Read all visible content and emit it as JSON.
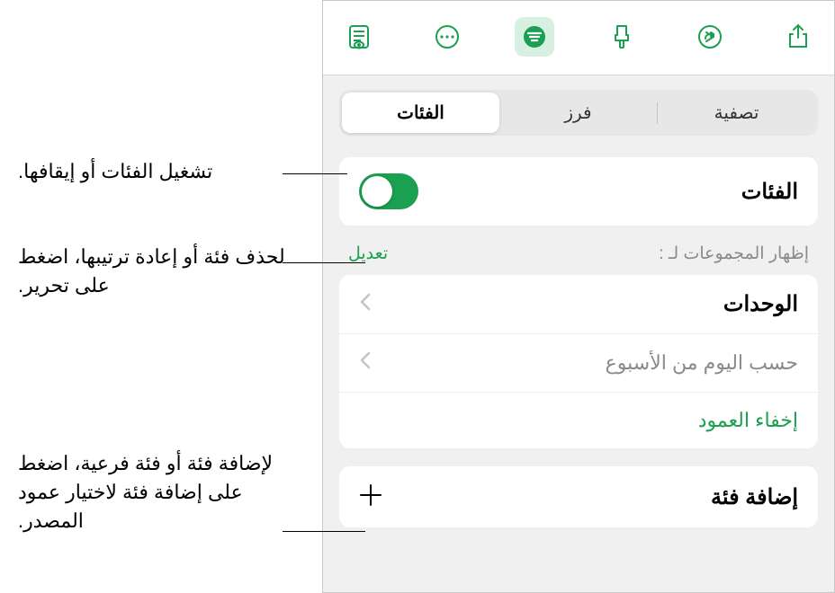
{
  "colors": {
    "accent": "#1aa050",
    "panel_bg": "#eff0ef",
    "placeholder": "#8a8a8a"
  },
  "toolbar_icons": {
    "share": "share-icon",
    "redo": "redo-arrow-icon",
    "format": "format-brush-icon",
    "organize": "organize-icon",
    "more": "more-ellipsis-icon",
    "view": "view-options-icon"
  },
  "segmented": {
    "tab1": "الفئات",
    "tab2": "فرز",
    "tab3": "تصفية",
    "selected": "الفئات"
  },
  "categories_row": {
    "label": "الفئات",
    "toggle_on": true
  },
  "groups_header": {
    "label": "إظهار المجموعات لـ :",
    "edit": "تعديل"
  },
  "group_rows": [
    {
      "label": "الوحدات",
      "secondary": false
    },
    {
      "label": "حسب اليوم من الأسبوع",
      "secondary": true
    }
  ],
  "hide_column": "إخفاء العمود",
  "add_category": "إضافة فئة",
  "callouts": {
    "c1": "تشغيل الفئات أو إيقافها.",
    "c2": "لحذف فئة أو إعادة ترتيبها، اضغط على تحرير.",
    "c3": "لإضافة فئة أو فئة فرعية، اضغط على إضافة فئة لاختيار عمود المصدر."
  }
}
